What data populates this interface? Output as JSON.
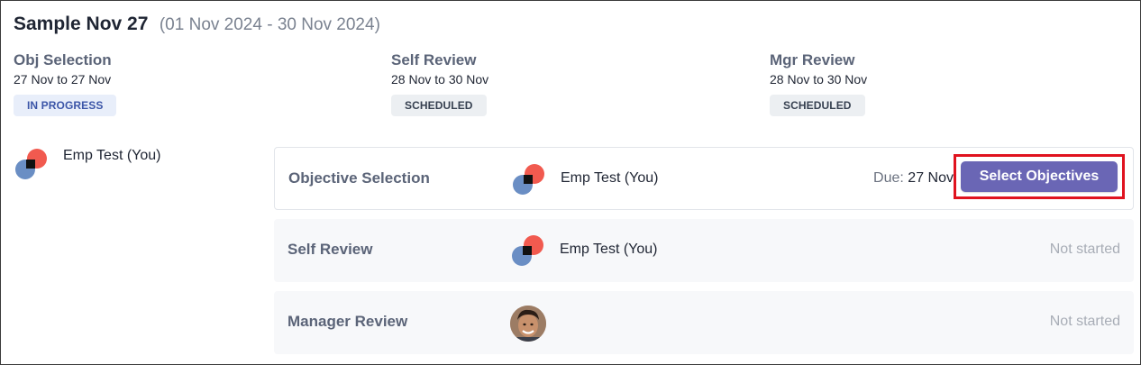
{
  "cycle": {
    "title": "Sample Nov 27",
    "date_range": "(01 Nov 2024 - 30 Nov 2024)"
  },
  "phases": [
    {
      "name": "Obj Selection",
      "dates": "27 Nov to 27 Nov",
      "status": "IN PROGRESS"
    },
    {
      "name": "Self Review",
      "dates": "28 Nov to 30 Nov",
      "status": "SCHEDULED"
    },
    {
      "name": "Mgr Review",
      "dates": "28 Nov to 30 Nov",
      "status": "SCHEDULED"
    }
  ],
  "employee": {
    "name": "Emp Test (You)"
  },
  "steps": [
    {
      "label": "Objective Selection",
      "assignee": "Emp Test (You)",
      "due_label": "Due:",
      "due_date": "27 Nov",
      "action": "Select Objectives"
    },
    {
      "label": "Self Review",
      "assignee": "Emp Test (You)",
      "status": "Not started"
    },
    {
      "label": "Manager Review",
      "status": "Not started"
    }
  ],
  "colors": {
    "accent": "#6a66b5",
    "highlight": "#e0131f",
    "badge_progress_bg": "#e8eefa",
    "badge_scheduled_bg": "#eceff2"
  }
}
